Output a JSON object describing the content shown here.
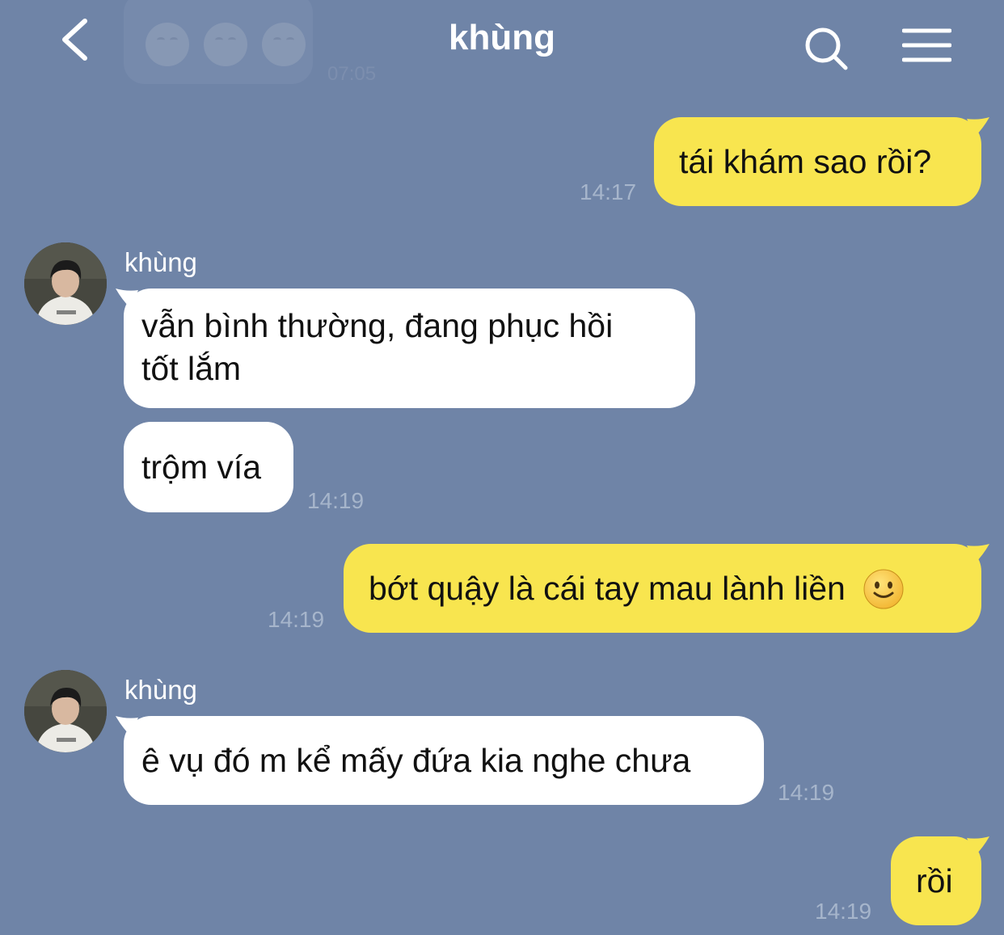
{
  "header": {
    "title": "khùng",
    "back_icon": "chevron-left-icon",
    "search_icon": "search-icon",
    "menu_icon": "hamburger-menu-icon"
  },
  "ghost_message": {
    "time": "07:05"
  },
  "messages": [
    {
      "id": "m1",
      "side": "mine",
      "text": "tái khám sao rồi?",
      "time": "14:17"
    },
    {
      "id": "m2",
      "side": "theirs",
      "sender": "khùng",
      "lines": [
        "vẫn bình thường, đang phục hồi",
        "tốt lắm"
      ]
    },
    {
      "id": "m3",
      "side": "theirs",
      "text": "trộm vía",
      "time": "14:19"
    },
    {
      "id": "m4",
      "side": "mine",
      "text": "bớt quậy là cái tay mau lành liền",
      "emoji": "slightly-smiling-face-emoji",
      "time": "14:19"
    },
    {
      "id": "m5",
      "side": "theirs",
      "sender": "khùng",
      "text": "ê vụ đó m kể mấy đứa kia nghe chưa",
      "time": "14:19"
    },
    {
      "id": "m6",
      "side": "mine",
      "text": "rồi",
      "time": "14:19"
    }
  ],
  "colors": {
    "background": "#6f84a7",
    "mine_bubble": "#f8e54f",
    "theirs_bubble": "#ffffff",
    "time_text": "#a6b5cb",
    "header_text": "#ffffff"
  }
}
